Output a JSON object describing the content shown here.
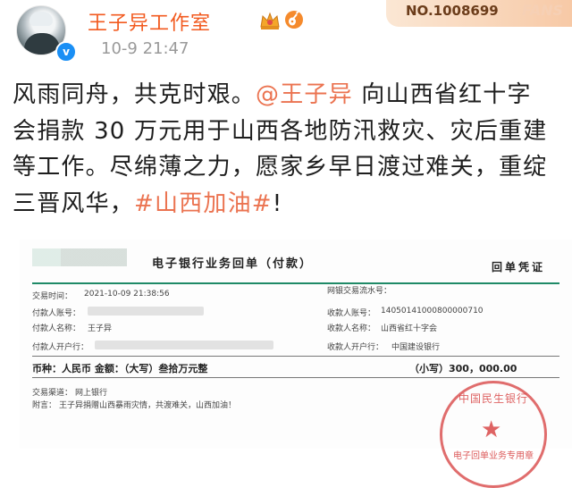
{
  "post": {
    "author": "王子异工作室",
    "time": "10-9 21:47",
    "fans_number": "NO.1008699",
    "fans_label": "FANS",
    "verified_mark": "v",
    "body_lines": [
      [
        {
          "text": "风雨同舟，共克时艰。",
          "type": "plain"
        },
        {
          "text": "@王子异",
          "type": "mention"
        },
        {
          "text": " 向山西省红十字",
          "type": "plain"
        }
      ],
      [
        {
          "text": "会捐款 30 万元用于山西各地防汛救灾、灾后重建",
          "type": "plain"
        }
      ],
      [
        {
          "text": "等工作。尽绵薄之力，愿家乡早日渡过难关，重绽",
          "type": "plain"
        }
      ],
      [
        {
          "text": "三晋风华，",
          "type": "plain"
        },
        {
          "text": "#山西加油#",
          "type": "hashtag"
        },
        {
          "text": "!",
          "type": "plain"
        }
      ]
    ]
  },
  "receipt": {
    "title": "电子银行业务回单（付款）",
    "voucher": "回单凭证",
    "trade_time_label": "交易时间：",
    "trade_time": "2021-10-09 21:38:56",
    "serial_label": "网银交易流水号：",
    "payer_account_label": "付款人账号：",
    "payee_account_label": "收款人账号：",
    "payee_account": "14050141000800000710",
    "payer_name_label": "付款人名称：",
    "payer_name": "王子异",
    "payee_name_label": "收款人名称：",
    "payee_name": "山西省红十字会",
    "payer_bank_label": "付款人开户行：",
    "payee_bank_label": "收款人开户行：",
    "payee_bank": "中国建设银行",
    "currency_amount": "币种：人民币  金额：（大写）叁拾万元整",
    "amount_small_label": "（小写）",
    "amount_small": "300，000.00",
    "channel_label": "交易渠道：",
    "channel": "网上银行",
    "remark_label": "附言：",
    "remark": "王子异捐赠山西暴雨灾情，共渡难关，山西加油！",
    "seal_top": "中国民生银行",
    "seal_bottom": "电子回单业务专用章"
  },
  "colors": {
    "author": "#f25a1f",
    "link": "#eb7350",
    "verified": "#1a8ff5",
    "receipt_rule": "#1f8a67",
    "seal": "#d63c3c"
  }
}
